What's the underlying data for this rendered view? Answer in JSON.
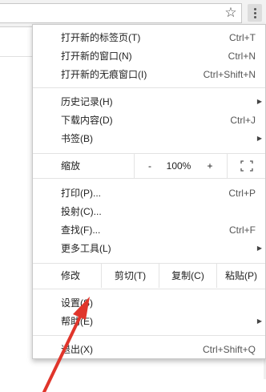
{
  "toolbar": {
    "star_glyph": "☆",
    "star_icon": "star-icon",
    "menu_icon": "more-vert-icon"
  },
  "menu": {
    "top_items": [
      {
        "label": "打开新的标签页(T)",
        "shortcut": "Ctrl+T"
      },
      {
        "label": "打开新的窗口(N)",
        "shortcut": "Ctrl+N"
      },
      {
        "label": "打开新的无痕窗口(I)",
        "shortcut": "Ctrl+Shift+N"
      }
    ],
    "history_label": "历史记录(H)",
    "downloads_label": "下载内容(D)",
    "downloads_shortcut": "Ctrl+J",
    "bookmarks_label": "书签(B)",
    "zoom": {
      "label": "缩放",
      "minus": "-",
      "value": "100%",
      "plus": "+"
    },
    "print_label": "打印(P)...",
    "print_shortcut": "Ctrl+P",
    "cast_label": "投射(C)...",
    "find_label": "查找(F)...",
    "find_shortcut": "Ctrl+F",
    "more_tools_label": "更多工具(L)",
    "edit": {
      "label": "修改",
      "cut": "剪切(T)",
      "copy": "复制(C)",
      "paste": "粘贴(P)"
    },
    "settings_label": "设置(S)",
    "help_label": "帮助(E)",
    "exit_label": "退出(X)",
    "exit_shortcut": "Ctrl+Shift+Q",
    "submenu_arrow": "▶"
  },
  "colors": {
    "annotation_arrow": "#e0352b"
  }
}
